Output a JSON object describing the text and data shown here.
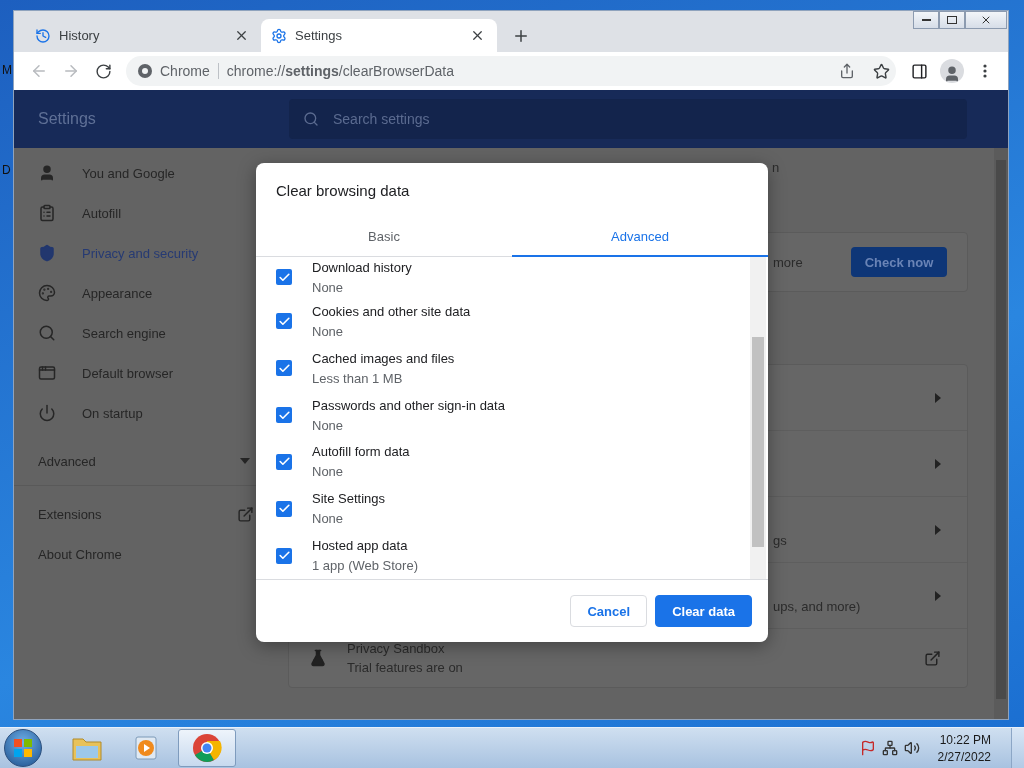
{
  "desktop": {
    "labels": [
      "M",
      "D"
    ]
  },
  "tabs": [
    {
      "title": "History",
      "selected": false
    },
    {
      "title": "Settings",
      "selected": true
    }
  ],
  "toolbar": {
    "forward_disabled": true,
    "site_label": "Chrome",
    "url": "chrome://**settings**/clearBrowserData"
  },
  "settings_header": {
    "title": "Settings",
    "search_placeholder": "Search settings"
  },
  "sidebar": {
    "items": [
      {
        "label": "You and Google",
        "selected": false
      },
      {
        "label": "Autofill",
        "selected": false
      },
      {
        "label": "Privacy and security",
        "selected": true
      },
      {
        "label": "Appearance",
        "selected": false
      },
      {
        "label": "Search engine",
        "selected": false
      },
      {
        "label": "Default browser",
        "selected": false
      },
      {
        "label": "On startup",
        "selected": false
      }
    ],
    "advanced": {
      "label": "Advanced",
      "expanded": false
    },
    "links": [
      {
        "label": "Extensions",
        "external": true
      },
      {
        "label": "About Chrome",
        "external": false
      }
    ]
  },
  "background": {
    "top_fragment": "n",
    "safety_card": {
      "fragment": "more",
      "button": "Check now"
    },
    "rows": [
      {
        "kind": "arrow"
      },
      {
        "kind": "arrow"
      },
      {
        "kind": "arrow",
        "fragment": "gs"
      },
      {
        "kind": "arrow",
        "fragment": "ups, and more)"
      },
      {
        "kind": "external",
        "title": "Privacy Sandbox",
        "subtitle": "Trial features are on"
      }
    ]
  },
  "dialog": {
    "title": "Clear browsing data",
    "tabs": [
      {
        "label": "Basic",
        "selected": false
      },
      {
        "label": "Advanced",
        "selected": true
      }
    ],
    "items": [
      {
        "label": "Download history",
        "detail": "None",
        "checked": true
      },
      {
        "label": "Cookies and other site data",
        "detail": "None",
        "checked": true
      },
      {
        "label": "Cached images and files",
        "detail": "Less than 1 MB",
        "checked": true
      },
      {
        "label": "Passwords and other sign-in data",
        "detail": "None",
        "checked": true
      },
      {
        "label": "Autofill form data",
        "detail": "None",
        "checked": true
      },
      {
        "label": "Site Settings",
        "detail": "None",
        "checked": true
      },
      {
        "label": "Hosted app data",
        "detail": "1 app (Web Store)",
        "checked": true
      }
    ],
    "buttons": [
      {
        "label": "Cancel",
        "kind": "secondary"
      },
      {
        "label": "Clear data",
        "kind": "primary"
      }
    ]
  },
  "taskbar": {
    "apps": [
      {
        "kind": "folder",
        "active": false
      },
      {
        "kind": "media",
        "active": false
      },
      {
        "kind": "browser",
        "active": true
      }
    ],
    "clock": {
      "time": "10:22 PM",
      "date": "2/27/2022"
    }
  }
}
